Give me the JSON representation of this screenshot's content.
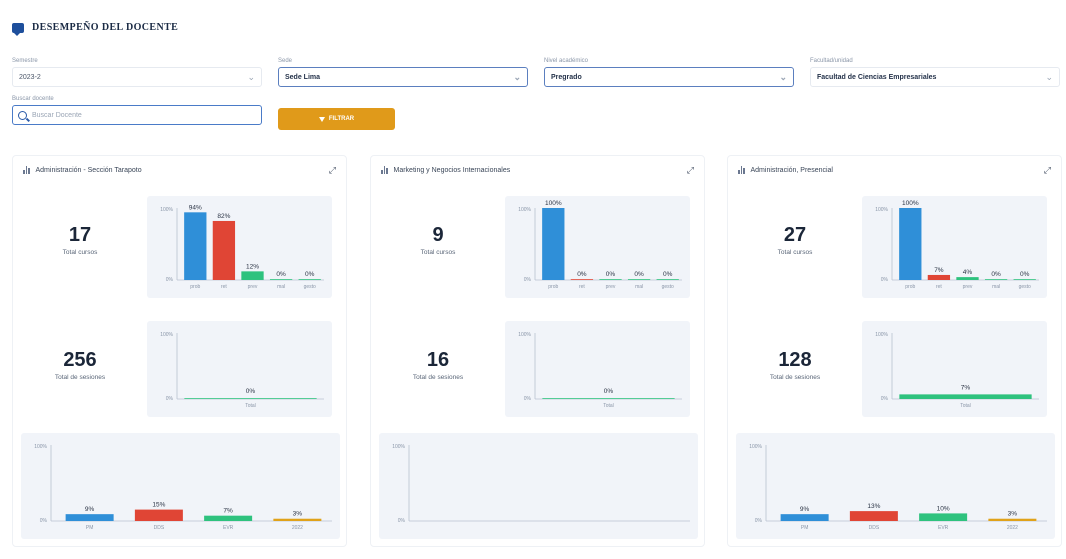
{
  "header": {
    "title": "DESEMPEÑO DEL DOCENTE"
  },
  "filters": [
    {
      "label": "Semestre",
      "value": "2023-2",
      "style": "plain"
    },
    {
      "label": "Sede",
      "value": "Sede Lima",
      "style": "active"
    },
    {
      "label": "Nivel académico",
      "value": "Pregrado",
      "style": "active"
    },
    {
      "label": "Facultad/unidad",
      "value": "Facultad de Ciencias Empresariales",
      "style": "plain"
    }
  ],
  "search": {
    "label": "Buscar docente",
    "placeholder": "Buscar Docente"
  },
  "filter_button": {
    "label": "FILTRAR"
  },
  "panels": [
    {
      "title": "Administración - Sección Tarapoto",
      "total_cursos": "17",
      "total_cursos_label": "Total cursos",
      "total_sesiones": "256",
      "total_sesiones_label": "Total de sesiones",
      "chart1": {
        "categories": [
          "prob",
          "ret",
          "prev",
          "mal",
          "gesto"
        ],
        "values": [
          94,
          82,
          12,
          0,
          0
        ],
        "labels": [
          "94%",
          "82%",
          "12%",
          "0%",
          "0%"
        ],
        "colors": [
          "#2f8fd8",
          "#e04535",
          "#2ec27e",
          "#2ec27e",
          "#2ec27e"
        ]
      },
      "chart2": {
        "category": "Total",
        "value": 0,
        "label": "0%"
      },
      "chart3": {
        "categories": [
          "PM",
          "DDS",
          "EVR",
          "2022"
        ],
        "values": [
          9,
          15,
          7,
          3
        ],
        "labels": [
          "9%",
          "15%",
          "7%",
          "3%"
        ],
        "colors": [
          "#2f8fd8",
          "#e04535",
          "#2ec27e",
          "#e0a21a"
        ]
      }
    },
    {
      "title": "Marketing y Negocios Internacionales",
      "total_cursos": "9",
      "total_cursos_label": "Total cursos",
      "total_sesiones": "16",
      "total_sesiones_label": "Total de sesiones",
      "chart1": {
        "categories": [
          "prob",
          "ret",
          "prev",
          "mal",
          "gesto"
        ],
        "values": [
          100,
          0,
          0,
          0,
          0
        ],
        "labels": [
          "100%",
          "0%",
          "0%",
          "0%",
          "0%"
        ],
        "colors": [
          "#2f8fd8",
          "#e04535",
          "#2ec27e",
          "#2ec27e",
          "#2ec27e"
        ]
      },
      "chart2": {
        "category": "Total",
        "value": 0,
        "label": "0%"
      },
      "chart3": null
    },
    {
      "title": "Administración, Presencial",
      "total_cursos": "27",
      "total_cursos_label": "Total cursos",
      "total_sesiones": "128",
      "total_sesiones_label": "Total de sesiones",
      "chart1": {
        "categories": [
          "prob",
          "ret",
          "prev",
          "mal",
          "gesto"
        ],
        "values": [
          100,
          7,
          4,
          0,
          0
        ],
        "labels": [
          "100%",
          "7%",
          "4%",
          "0%",
          "0%"
        ],
        "colors": [
          "#2f8fd8",
          "#e04535",
          "#2ec27e",
          "#2ec27e",
          "#2ec27e"
        ]
      },
      "chart2": {
        "category": "Total",
        "value": 7,
        "label": "7%"
      },
      "chart3": {
        "categories": [
          "PM",
          "DDS",
          "EVR",
          "2022"
        ],
        "values": [
          9,
          13,
          10,
          3
        ],
        "labels": [
          "9%",
          "13%",
          "10%",
          "3%"
        ],
        "colors": [
          "#2f8fd8",
          "#e04535",
          "#2ec27e",
          "#e0a21a"
        ]
      }
    }
  ],
  "axis": {
    "max_label": "100%",
    "min_label": "0%"
  }
}
